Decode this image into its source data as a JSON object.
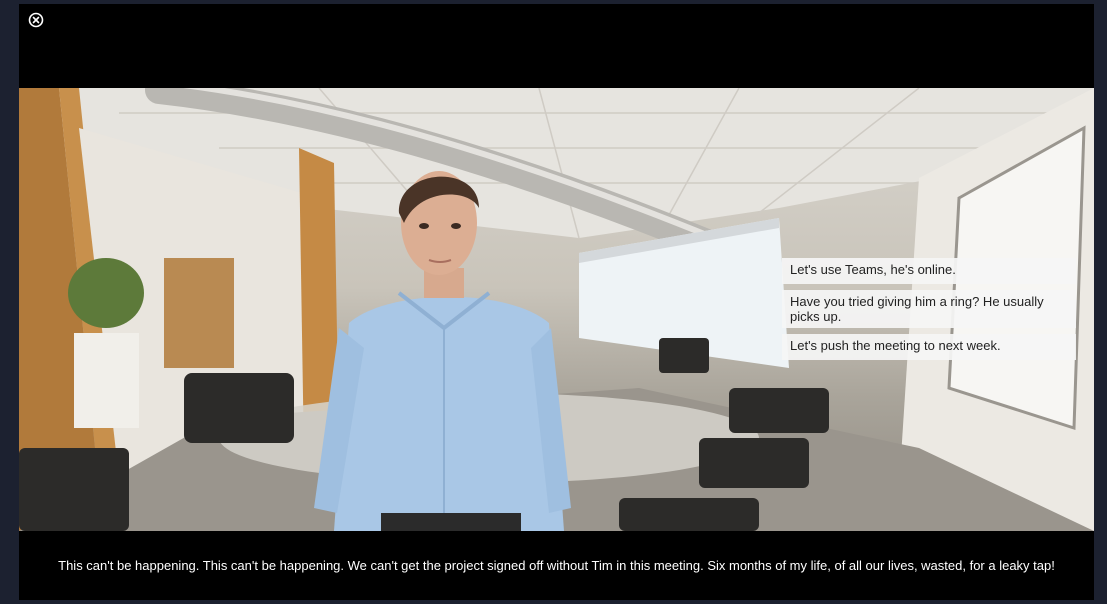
{
  "player": {
    "close_icon": "close-circle-icon"
  },
  "scene": {
    "description_icon": "office-scene"
  },
  "dialogue_options": [
    {
      "label": "Let's use Teams, he's online."
    },
    {
      "label": "Have you tried giving him a ring? He usually picks up."
    },
    {
      "label": "Let's push the meeting to next week."
    }
  ],
  "subtitle": {
    "text": "This can't be happening. This can't be happening. We can't get the project signed off without Tim in this meeting. Six months of my life, of all our lives, wasted, for a leaky tap!"
  },
  "colors": {
    "page_background": "#1c2130",
    "player_background": "#000000",
    "option_background": "#f5f5f5"
  }
}
